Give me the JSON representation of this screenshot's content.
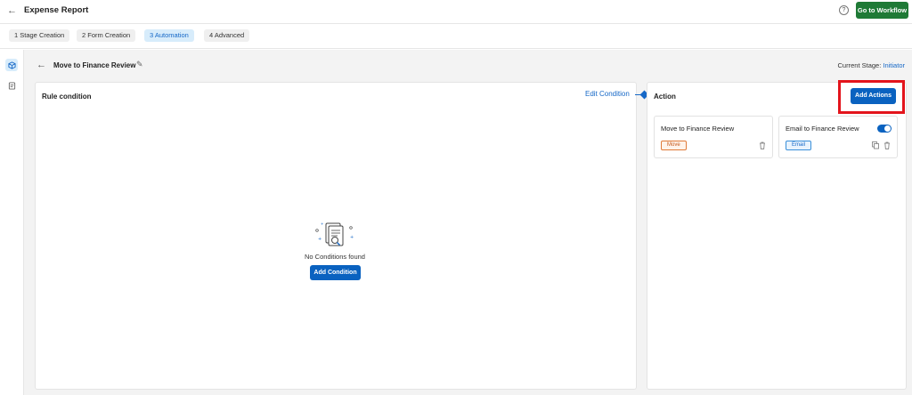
{
  "header": {
    "back_icon": "arrow-left-icon",
    "title": "Expense Report",
    "help_icon": "question-circle-icon",
    "go_to_workflow_label": "Go to Workflow",
    "go_to_workflow_color": "#1f7a36"
  },
  "steps": [
    {
      "label": "1 Stage Creation",
      "active": false
    },
    {
      "label": "2 Form Creation",
      "active": false
    },
    {
      "label": "3 Automation",
      "active": true
    },
    {
      "label": "4 Advanced",
      "active": false
    }
  ],
  "rail": {
    "items": [
      {
        "icon": "cube-icon",
        "active": true
      },
      {
        "icon": "form-icon",
        "active": false
      }
    ]
  },
  "subheader": {
    "title": "Move to Finance Review",
    "current_stage_label": "Current Stage:",
    "current_stage_value": "Initiator"
  },
  "rule": {
    "title": "Rule condition",
    "edit_label": "Edit Condition",
    "empty_text": "No Conditions found",
    "add_condition_label": "Add Condition"
  },
  "action": {
    "title": "Action",
    "add_actions_label": "Add Actions",
    "cards": [
      {
        "title": "Move to Finance Review",
        "tag": "Move",
        "toggle": null
      },
      {
        "title": "Email to Finance Review",
        "tag": "Email",
        "toggle": true
      }
    ]
  },
  "colors": {
    "accent": "#1668c7",
    "primary_button": "#0a62c0",
    "highlight": "#e3141c"
  }
}
